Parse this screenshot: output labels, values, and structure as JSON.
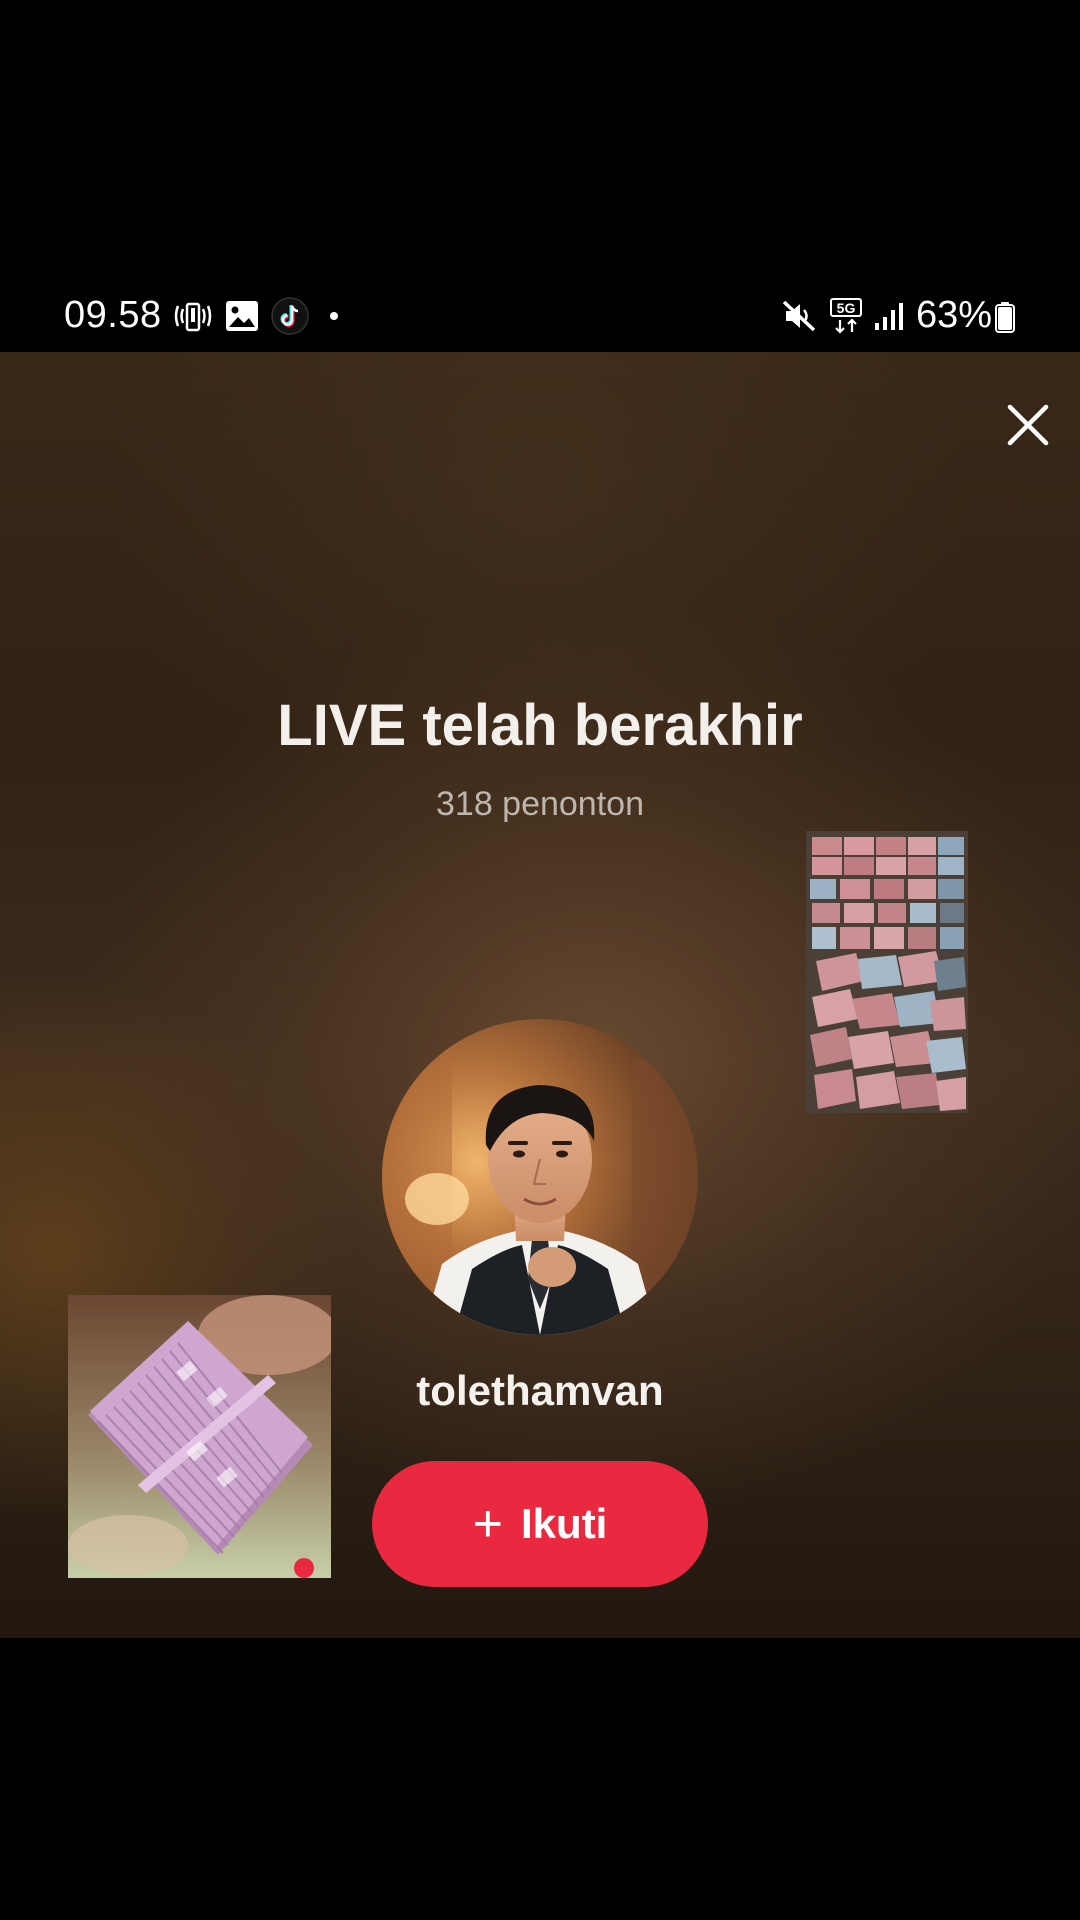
{
  "status_bar": {
    "time": "09.58",
    "left_icons": [
      "call-recording-icon",
      "gallery-icon",
      "tiktok-icon",
      "dot-icon"
    ],
    "right_icons": [
      "mute-icon",
      "5g-icon",
      "signal-icon",
      "battery-icon"
    ],
    "network_label": "5G",
    "battery_text": "63%",
    "battery_level": 0.63
  },
  "live_ended": {
    "title": "LIVE telah berakhir",
    "viewers": "318 penonton",
    "username": "tolethamvan",
    "follow_button": {
      "label": "Ikuti",
      "icon": "plus-icon"
    }
  },
  "colors": {
    "follow_button": "#e8293f",
    "title_text": "#f3f0ec",
    "secondary_text": "#bdb6ae"
  },
  "close_icon": "close-icon"
}
